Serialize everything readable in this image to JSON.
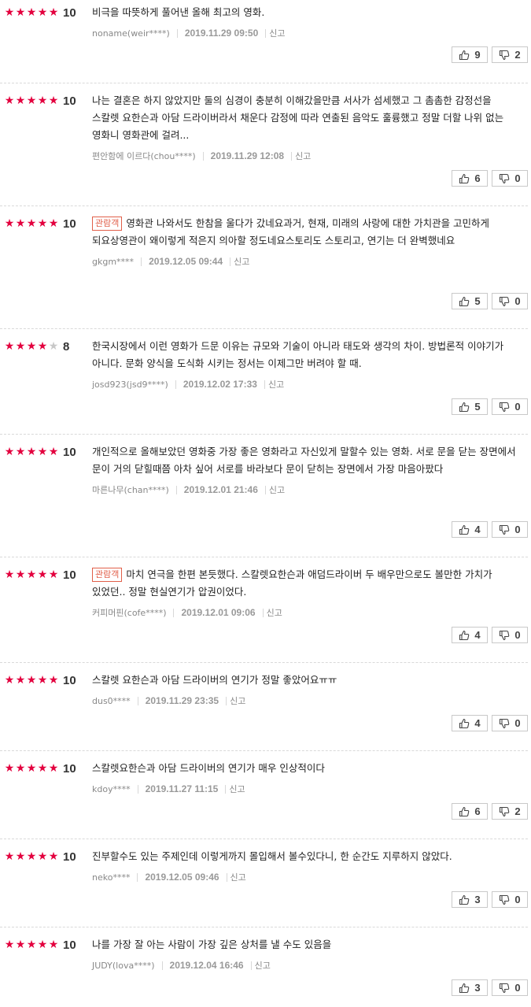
{
  "reviews": [
    {
      "stars": 5,
      "score": "10",
      "badge": "",
      "text": "비극을 따뜻하게 풀어낸 올해 최고의 영화.",
      "user": "noname(weir****)",
      "date": "2019.11.29 09:50",
      "report": "신고",
      "up": "9",
      "down": "2"
    },
    {
      "stars": 5,
      "score": "10",
      "badge": "",
      "text": "나는 결혼은 하지 않았지만 둘의 심경이 충분히 이해갔을만큼 서사가 섬세했고 그 촘촘한 감정선을 스칼렛 요한슨과 아담 드라이버라서 채운다 감정에 따라 연출된 음악도 훌륭했고 정말 더할 나위 없는 영화니 영화관에 걸려...",
      "user": "편안함에 이르다(chou****)",
      "date": "2019.11.29 12:08",
      "report": "신고",
      "up": "6",
      "down": "0"
    },
    {
      "stars": 5,
      "score": "10",
      "badge": "관람객",
      "text": "영화관 나와서도 한참을 울다가 갔네요과거, 현재, 미래의 사랑에 대한 가치관을 고민하게 되요상영관이 왜이렇게 적은지 의아할 정도네요스토리도 스토리고, 연기는 더 완벽했네요",
      "user": "gkgm****",
      "date": "2019.12.05 09:44",
      "report": "신고",
      "up": "5",
      "down": "0"
    },
    {
      "stars": 4,
      "score": "8",
      "badge": "",
      "text": "한국시장에서 이런 영화가 드문 이유는 규모와 기술이 아니라 태도와 생각의 차이. 방법론적 이야기가 아니다. 문화 양식을 도식화 시키는 정서는 이제그만 버려야 할 때.",
      "user": "josd923(jsd9****)",
      "date": "2019.12.02 17:33",
      "report": "신고",
      "up": "5",
      "down": "0"
    },
    {
      "stars": 5,
      "score": "10",
      "badge": "",
      "text": "개인적으로 올해보았던 영화중 가장 좋은 영화라고 자신있게 말할수 있는 영화. 서로 문을 닫는 장면에서 문이 거의 닫힐때쯤 아차 싶어 서로를 바라보다 문이 닫히는 장면에서 가장 마음아팠다",
      "user": "마른나무(chan****)",
      "date": "2019.12.01 21:46",
      "report": "신고",
      "up": "4",
      "down": "0"
    },
    {
      "stars": 5,
      "score": "10",
      "badge": "관람객",
      "text": "마치 연극을 한편 본듯했다. 스칼렛요한슨과 애덤드라이버 두 배우만으로도 볼만한 가치가 있었던.. 정말 현실연기가 압권이었다.",
      "user": "커피머핀(cofe****)",
      "date": "2019.12.01 09:06",
      "report": "신고",
      "up": "4",
      "down": "0"
    },
    {
      "stars": 5,
      "score": "10",
      "badge": "",
      "text": "스칼렛 요한슨과 아담 드라이버의 연기가 정말 좋았어요ㅠㅠ",
      "user": "dus0****",
      "date": "2019.11.29 23:35",
      "report": "신고",
      "up": "4",
      "down": "0"
    },
    {
      "stars": 5,
      "score": "10",
      "badge": "",
      "text": "스칼렛요한슨과 아담 드라이버의 연기가 매우 인상적이다",
      "user": "kdoy****",
      "date": "2019.11.27 11:15",
      "report": "신고",
      "up": "6",
      "down": "2"
    },
    {
      "stars": 5,
      "score": "10",
      "badge": "",
      "text": "진부할수도 있는 주제인데 이렇게까지 몰입해서 볼수있다니, 한 순간도 지루하지 않았다.",
      "user": "neko****",
      "date": "2019.12.05 09:46",
      "report": "신고",
      "up": "3",
      "down": "0"
    },
    {
      "stars": 5,
      "score": "10",
      "badge": "",
      "text": "나를 가장 잘 아는 사람이 가장 깊은 상처를 낼 수도 있음을",
      "user": "JUDY(lova****)",
      "date": "2019.12.04 16:46",
      "report": "신고",
      "up": "3",
      "down": "0"
    }
  ]
}
